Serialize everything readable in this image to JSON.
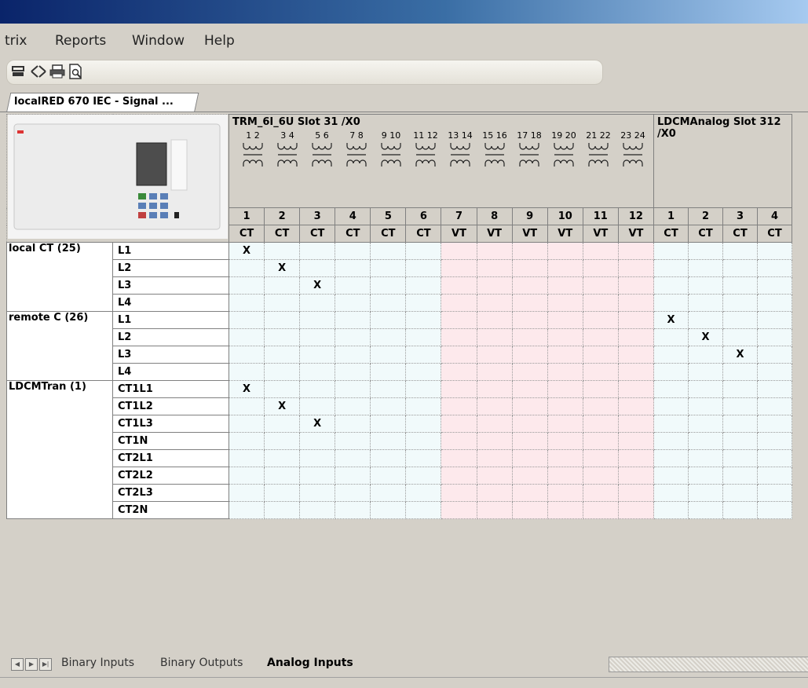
{
  "menu": [
    "trix",
    "Reports",
    "Window",
    "Help"
  ],
  "document_tab": "localRED 670 IEC - Signal ...",
  "slots": [
    {
      "title": "TRM_6I_6U Slot 31 /X0",
      "span": 12
    },
    {
      "title": "LDCMAnalog Slot 312 /X0",
      "span": 4
    }
  ],
  "coil_pins": [
    "1 2",
    "3 4",
    "5 6",
    "7 8",
    "9 10",
    "11 12",
    "13 14",
    "15 16",
    "17 18",
    "19 20",
    "21 22",
    "23 24"
  ],
  "channels": [
    "1",
    "2",
    "3",
    "4",
    "5",
    "6",
    "7",
    "8",
    "9",
    "10",
    "11",
    "12",
    "1",
    "2",
    "3",
    "4"
  ],
  "channel_types": [
    "CT",
    "CT",
    "CT",
    "CT",
    "CT",
    "CT",
    "VT",
    "VT",
    "VT",
    "VT",
    "VT",
    "VT",
    "CT",
    "CT",
    "CT",
    "CT"
  ],
  "mark": "X",
  "groups": [
    {
      "name": "local CT (25)",
      "rows": [
        {
          "label": "L1",
          "mark_col": 0
        },
        {
          "label": "L2",
          "mark_col": 1
        },
        {
          "label": "L3",
          "mark_col": 2
        },
        {
          "label": "L4",
          "mark_col": -1
        }
      ]
    },
    {
      "name": "remote C (26)",
      "rows": [
        {
          "label": "L1",
          "mark_col": 12
        },
        {
          "label": "L2",
          "mark_col": 13
        },
        {
          "label": "L3",
          "mark_col": 14
        },
        {
          "label": "L4",
          "mark_col": -1
        }
      ]
    },
    {
      "name": "LDCMTran (1)",
      "rows": [
        {
          "label": "CT1L1",
          "mark_col": 0
        },
        {
          "label": "CT1L2",
          "mark_col": 1
        },
        {
          "label": "CT1L3",
          "mark_col": 2
        },
        {
          "label": "CT1N",
          "mark_col": -1
        },
        {
          "label": "CT2L1",
          "mark_col": -1
        },
        {
          "label": "CT2L2",
          "mark_col": -1
        },
        {
          "label": "CT2L3",
          "mark_col": -1
        },
        {
          "label": "CT2N",
          "mark_col": -1
        }
      ]
    }
  ],
  "sheet_tabs": [
    "Binary Inputs",
    "Binary Outputs",
    "Analog Inputs"
  ],
  "active_sheet": "Analog Inputs"
}
